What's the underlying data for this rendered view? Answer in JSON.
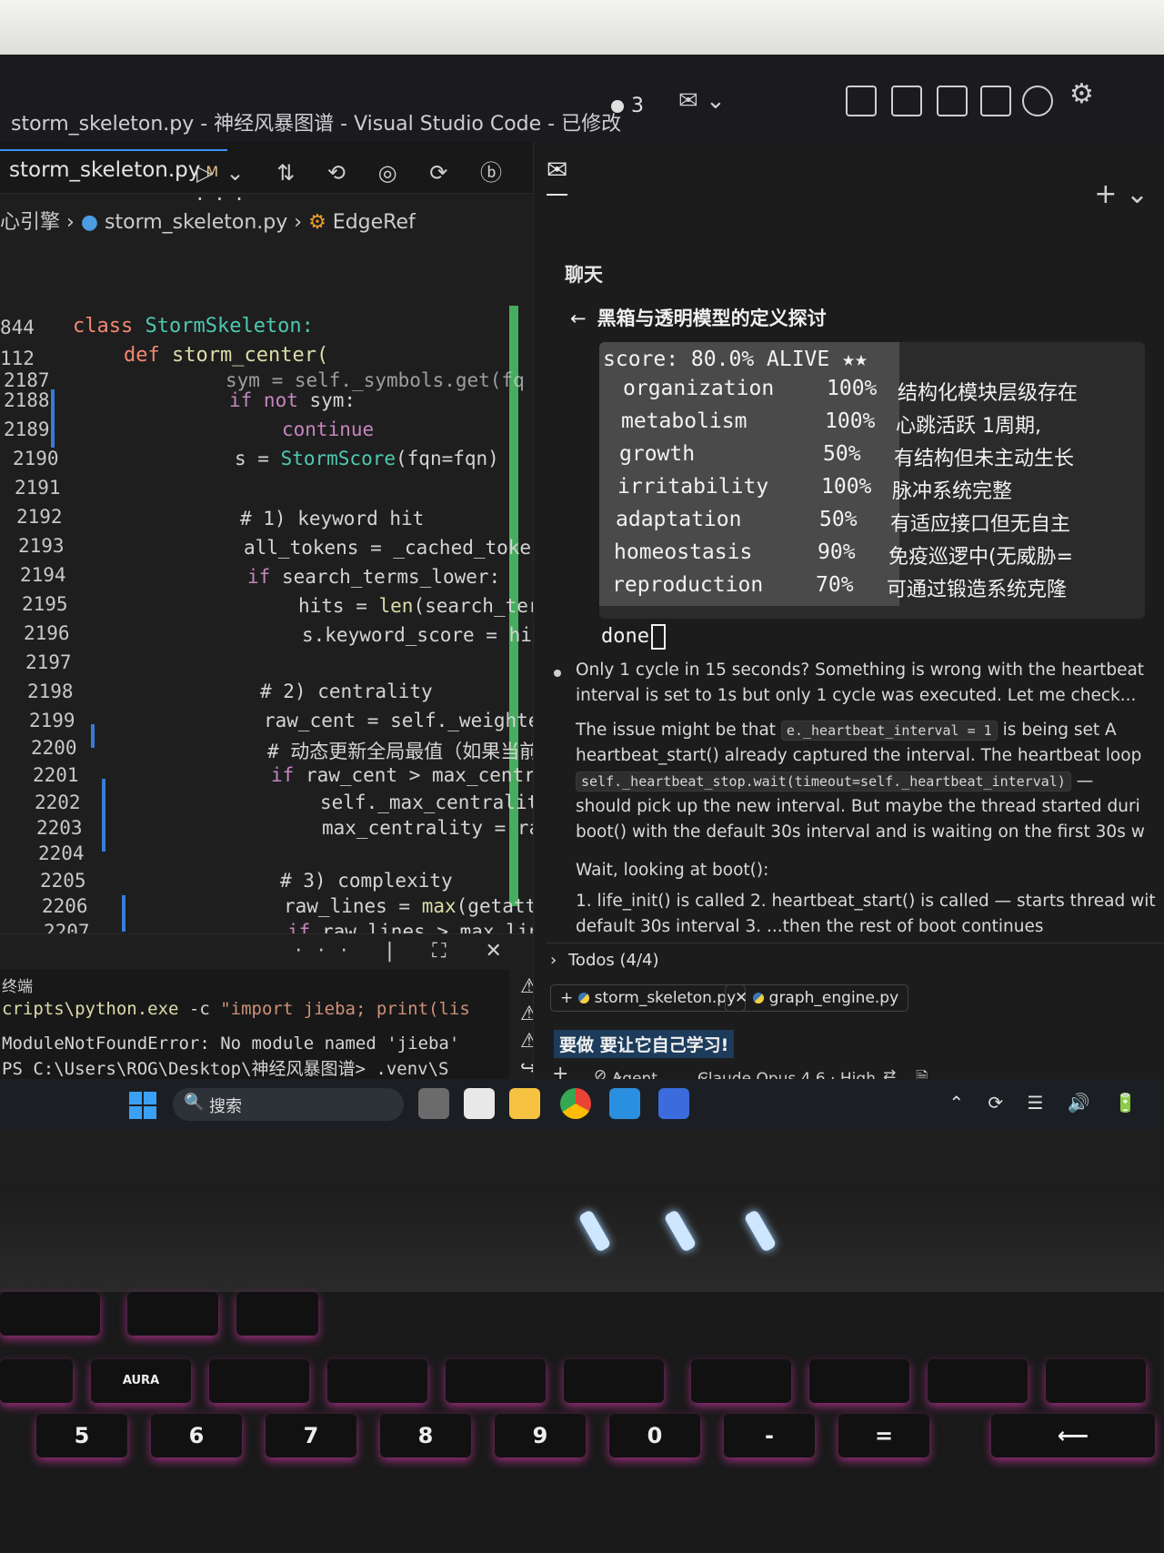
{
  "window": {
    "title": "storm_skeleton.py - 神经风暴图谱 - Visual Studio Code - 已修改",
    "problems_count": "3"
  },
  "editor": {
    "tab_label": "storm_skeleton.py",
    "tab_status": "M",
    "breadcrumb": {
      "folder": "心引擎",
      "file": "storm_skeleton.py",
      "symbol": "EdgeRef"
    },
    "sticky": [
      {
        "line": "844",
        "kw": "class",
        "name": "StormSkeleton:"
      },
      {
        "line": "112",
        "kw": "def",
        "name": "storm_center("
      }
    ],
    "line_numbers": [
      "2187",
      "2188",
      "2189",
      "2190",
      "2191",
      "2192",
      "2193",
      "2194",
      "2195",
      "2196",
      "2197",
      "2198",
      "2199",
      "2200",
      "2201",
      "2202",
      "2203",
      "2204",
      "2205",
      "2206",
      "2207"
    ],
    "code": {
      "l0": "sym = self._symbols.get(fq",
      "l1_kw": "if not",
      "l1_rest": " sym:",
      "l2": "continue",
      "l3_a": "s = ",
      "l3_cls": "StormScore",
      "l3_b": "(fqn=fqn)",
      "l4": "# 1) keyword hit",
      "l5": "all_tokens = _cached_toke",
      "l6_kw": "if",
      "l6_rest": " search_terms_lower:",
      "l7_a": "hits = ",
      "l7_fn": "len",
      "l7_b": "(search_ter",
      "l8": "s.keyword_score = hit",
      "l9": "# 2) centrality",
      "l10": "raw_cent = self._weighted",
      "l11": "# 动态更新全局最值（如果当前",
      "l12_kw": "if",
      "l12_rest": " raw_cent > max_centra",
      "l13": "self._max_centrality",
      "l14": "max_centrality = raw_",
      "l15": "# 3) complexity",
      "l16_a": "raw_lines = ",
      "l16_fn": "max",
      "l16_b": "(getattr(",
      "l17_kw": "if",
      "l17_rest": " raw_lines > max_lines"
    }
  },
  "terminal": {
    "title": "终端",
    "line1_cmd": "cripts\\python.exe",
    "line1_flag": " -c ",
    "line1_str": "\"import jieba; print(lis",
    "line2": "ModuleNotFoundError: No module named 'jieba'",
    "line3": "PS C:\\Users\\ROG\\Desktop\\神经风暴图谱> .venv\\S"
  },
  "chat": {
    "section_label": "聊天",
    "subject": "黑箱与透明模型的定义探讨",
    "score_line": "score: 80.0% ALIVE ★★",
    "metrics": [
      {
        "name": "organization",
        "pct": "100%",
        "desc": "结构化模块层级存在"
      },
      {
        "name": "metabolism",
        "pct": "100%",
        "desc": "心跳活跃 1周期,"
      },
      {
        "name": "growth",
        "pct": "50%",
        "desc": "有结构但未主动生长"
      },
      {
        "name": "irritability",
        "pct": "100%",
        "desc": "脉冲系统完整"
      },
      {
        "name": "adaptation",
        "pct": "50%",
        "desc": "有适应接口但无自主"
      },
      {
        "name": "homeostasis",
        "pct": "90%",
        "desc": "免疫巡逻中(无威胁="
      },
      {
        "name": "reproduction",
        "pct": "70%",
        "desc": "可通过锻造系统克隆"
      }
    ],
    "done": "done",
    "msg1": "Only 1 cycle in 15 seconds? Something is wrong with the heartbeat",
    "msg2": "interval is set to 1s but only 1 cycle was executed. Let me check...",
    "msg3_a": "The issue might be that ",
    "msg3_code": "e._heartbeat_interval = 1",
    "msg3_b": " is being set A",
    "msg4": "heartbeat_start() already captured the interval. The heartbeat loop",
    "msg5_code": "self._heartbeat_stop.wait(timeout=self._heartbeat_interval)",
    "msg5_b": " —",
    "msg6": "should pick up the new interval. But maybe the thread started duri",
    "msg7": "boot() with the default 30s interval and is waiting on the first 30s w",
    "msg8": "Wait, looking at boot():",
    "msg9": "1. life_init() is called 2. heartbeat_start() is called — starts thread wit",
    "msg10": "default 30s interval 3. ...then the rest of boot continues",
    "todos": "Todos (4/4)",
    "file1": "storm_skeleton.py",
    "file2": "graph_engine.py",
    "input_text": "要做 要让它自己学习!",
    "agent_label": "Agent",
    "model_label": "Claude Opus 4.6 · High"
  },
  "taskbar": {
    "search_placeholder": "搜索"
  },
  "keyboard": {
    "numrow": [
      "5",
      "6",
      "7",
      "8",
      "9",
      "0",
      "-",
      "="
    ],
    "fn_aura": "AURA"
  },
  "colors": {
    "accent": "#3794ff",
    "keyword": "#569cd6",
    "class": "#4ec9b0",
    "function": "#dcdcaa",
    "keyboard_glow": "#ff3cc8"
  }
}
